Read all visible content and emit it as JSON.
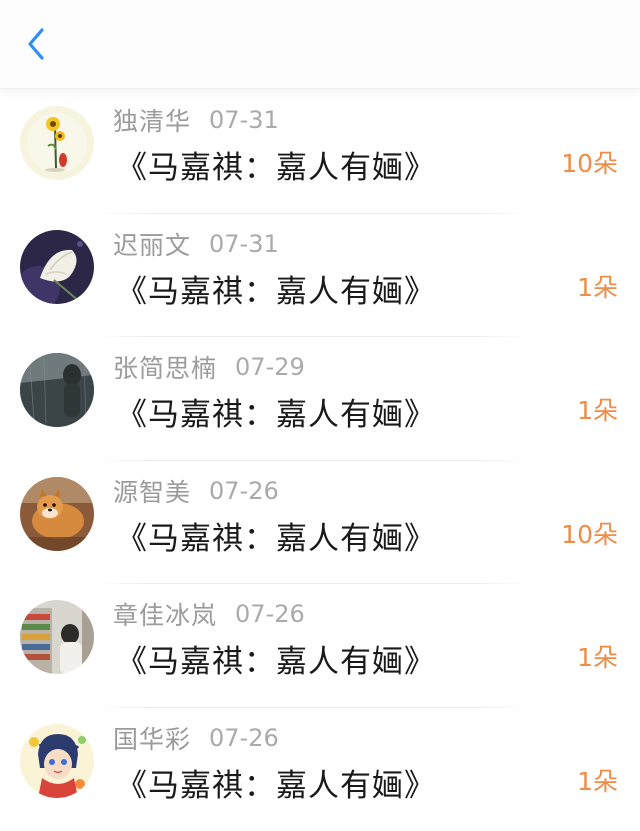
{
  "header": {
    "back_icon": "chevron-left-icon",
    "accent_color": "#2d8ef3"
  },
  "list": {
    "count_color": "#ef8c47",
    "items": [
      {
        "name": "独清华",
        "date": "07-31",
        "title": "《马嘉祺：嘉人有婳》",
        "count": "10朵"
      },
      {
        "name": "迟丽文",
        "date": "07-31",
        "title": "《马嘉祺：嘉人有婳》",
        "count": "1朵"
      },
      {
        "name": "张简思楠",
        "date": "07-29",
        "title": "《马嘉祺：嘉人有婳》",
        "count": "1朵"
      },
      {
        "name": "源智美",
        "date": "07-26",
        "title": "《马嘉祺：嘉人有婳》",
        "count": "10朵"
      },
      {
        "name": "章佳冰岚",
        "date": "07-26",
        "title": "《马嘉祺：嘉人有婳》",
        "count": "1朵"
      },
      {
        "name": "国华彩",
        "date": "07-26",
        "title": "《马嘉祺：嘉人有婳》",
        "count": "1朵"
      }
    ]
  }
}
